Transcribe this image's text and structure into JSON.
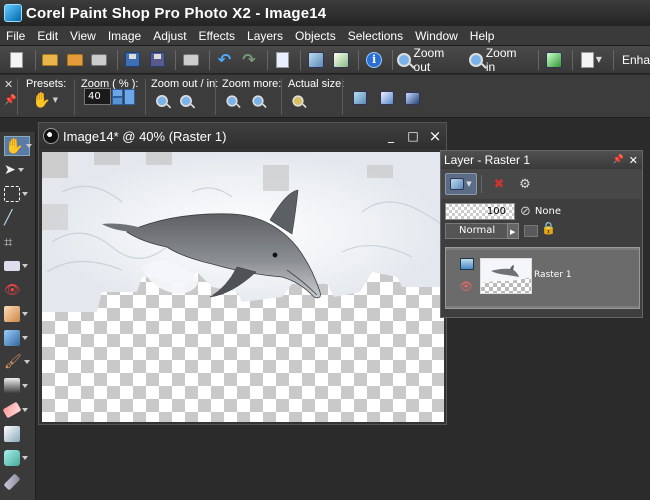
{
  "window": {
    "title": "Corel Paint Shop Pro Photo X2 - Image14"
  },
  "menu": [
    "File",
    "Edit",
    "View",
    "Image",
    "Adjust",
    "Effects",
    "Layers",
    "Objects",
    "Selections",
    "Window",
    "Help"
  ],
  "toolbar": {
    "zoom_out_label": "Zoom out",
    "zoom_in_label": "Zoom in",
    "enhance_label": "Enha"
  },
  "tool_options": {
    "presets_label": "Presets:",
    "zoom_pct_label": "Zoom ( % ):",
    "zoom_value": "40",
    "zoom_out_in_label": "Zoom out / in:",
    "zoom_more_label": "Zoom more:",
    "actual_size_label": "Actual size:"
  },
  "image_window": {
    "title": "Image14* @  40% (Raster 1)",
    "min_glyph": "_",
    "max_glyph": "□",
    "close_glyph": "×"
  },
  "layer_palette": {
    "title": "Layer - Raster 1",
    "opacity": "100",
    "none_label": "None",
    "blend_mode": "Normal",
    "layers": [
      {
        "name": "Raster 1"
      }
    ]
  },
  "colors": {
    "app_bg": "#2b2b2b",
    "checker_dark": "#c9c9c9",
    "accent_blue": "#4fa9ff"
  }
}
